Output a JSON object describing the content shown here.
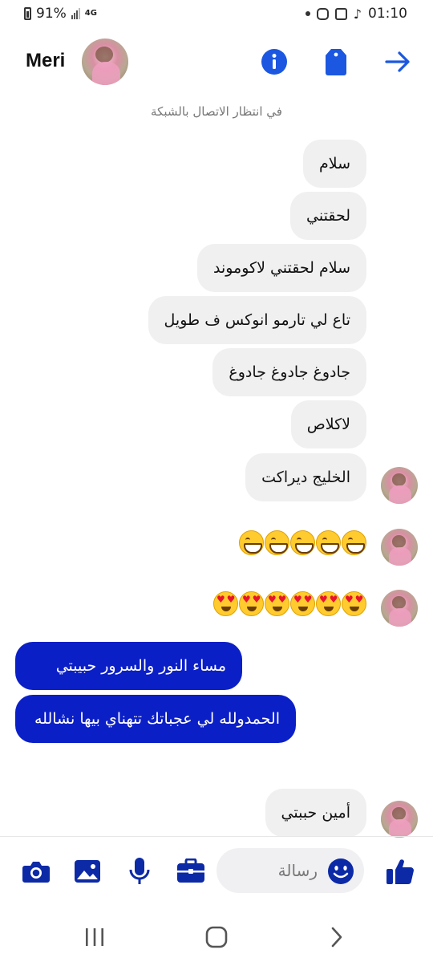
{
  "status_bar": {
    "battery": "91%",
    "network": "4G",
    "time": "01:10"
  },
  "header": {
    "contact_name": "Meri",
    "icons": [
      "info-icon",
      "tag-icon",
      "forward-arrow-icon"
    ]
  },
  "chat": {
    "status_text": "في انتظار الاتصال بالشبكة",
    "incoming": [
      "سلام",
      "لحقتني",
      "سلام لحقتني لاكوموند",
      "تاع لي تارمو انوكس ف طويل",
      "جادوغ جادوغ جادوغ",
      "لاكلاص",
      "الخليج ديراكت"
    ],
    "outgoing": [
      "مساء النور والسرور حبيبتي",
      "الحمدولله لي عجباتك تتهناي بيها نشالله"
    ],
    "last_incoming": "أمين حببتي",
    "emoji_rows": [
      {
        "type": "grinning-face",
        "count": 5
      },
      {
        "type": "heart-eyes-face",
        "count": 6
      }
    ]
  },
  "composer": {
    "placeholder": "رسالة",
    "icons": [
      "camera-icon",
      "image-icon",
      "microphone-icon",
      "briefcase-icon",
      "emoji-icon",
      "thumbs-up-icon"
    ]
  },
  "colors": {
    "accent": "#1b57e0",
    "outgoing_bubble": "#0b1fc7",
    "incoming_bubble": "#f0f0f0",
    "composer_icons": "#0c2aa6"
  }
}
